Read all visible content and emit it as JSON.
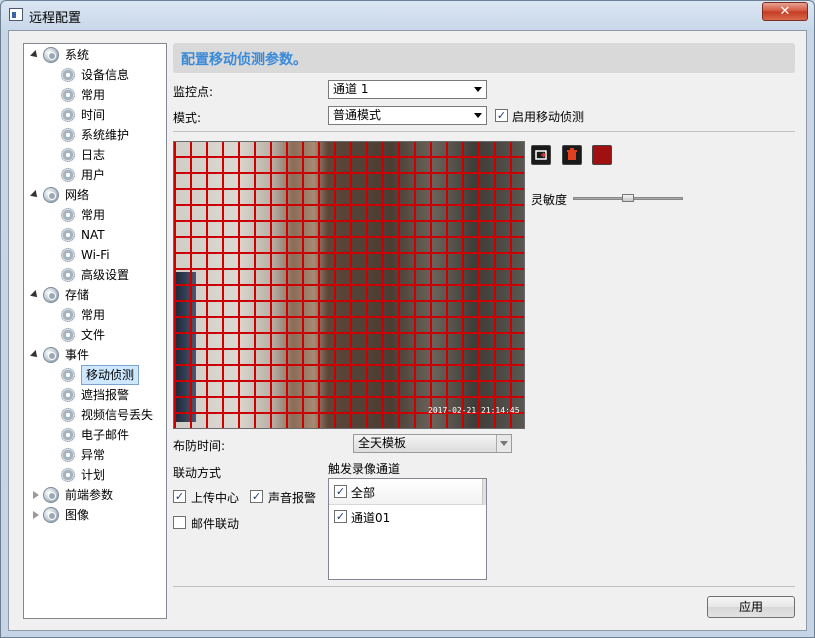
{
  "window": {
    "title": "远程配置",
    "close_glyph": "✕"
  },
  "tree": [
    {
      "label": "系统",
      "type": "category",
      "expanded": true,
      "icon": "globe-gear-icon"
    },
    {
      "label": "设备信息",
      "type": "item",
      "icon": "gear-icon"
    },
    {
      "label": "常用",
      "type": "item",
      "icon": "gear-icon"
    },
    {
      "label": "时间",
      "type": "item",
      "icon": "gear-icon"
    },
    {
      "label": "系统维护",
      "type": "item",
      "icon": "gear-icon"
    },
    {
      "label": "日志",
      "type": "item",
      "icon": "gear-icon"
    },
    {
      "label": "用户",
      "type": "item",
      "icon": "gear-icon"
    },
    {
      "label": "网络",
      "type": "category",
      "expanded": true,
      "icon": "globe-gear-icon"
    },
    {
      "label": "常用",
      "type": "item",
      "icon": "gear-icon"
    },
    {
      "label": "NAT",
      "type": "item",
      "icon": "gear-icon"
    },
    {
      "label": "Wi-Fi",
      "type": "item",
      "icon": "gear-icon"
    },
    {
      "label": "高级设置",
      "type": "item",
      "icon": "gear-icon"
    },
    {
      "label": "存储",
      "type": "category",
      "expanded": true,
      "icon": "globe-gear-icon"
    },
    {
      "label": "常用",
      "type": "item",
      "icon": "gear-icon"
    },
    {
      "label": "文件",
      "type": "item",
      "icon": "gear-icon"
    },
    {
      "label": "事件",
      "type": "category",
      "expanded": true,
      "icon": "globe-gear-icon"
    },
    {
      "label": "移动侦测",
      "type": "item",
      "icon": "gear-icon",
      "selected": true
    },
    {
      "label": "遮挡报警",
      "type": "item",
      "icon": "gear-icon"
    },
    {
      "label": "视频信号丢失",
      "type": "item",
      "icon": "gear-icon"
    },
    {
      "label": "电子邮件",
      "type": "item",
      "icon": "gear-icon"
    },
    {
      "label": "异常",
      "type": "item",
      "icon": "gear-icon"
    },
    {
      "label": "计划",
      "type": "item",
      "icon": "gear-icon"
    },
    {
      "label": "前端参数",
      "type": "category",
      "expanded": false,
      "icon": "globe-gear-icon"
    },
    {
      "label": "图像",
      "type": "category",
      "expanded": false,
      "icon": "globe-gear-icon"
    }
  ],
  "main": {
    "header": "配置移动侦测参数。",
    "channel_label": "监控点:",
    "channel_value": "通道 1",
    "mode_label": "模式:",
    "mode_value": "普通模式",
    "enable_motion_label": "启用移动侦测",
    "enable_motion_checked": true,
    "sensitivity_label": "灵敏度",
    "sensitivity_level": 0.5,
    "video": {
      "osd_top_1": "",
      "osd_top_2": "",
      "timestamp": "2017-02-21 21:14:45"
    },
    "schedule_label": "布防时间:",
    "schedule_value": "全天模板",
    "linkage_label": "联动方式",
    "upload_center_label": "上传中心",
    "upload_center_checked": true,
    "audio_alarm_label": "声音报警",
    "audio_alarm_checked": true,
    "email_linkage_label": "邮件联动",
    "email_linkage_checked": false,
    "trigger_record_label": "触发录像通道",
    "trigger_all_label": "全部",
    "trigger_all_checked": true,
    "trigger_ch01_label": "通道01",
    "trigger_ch01_checked": true,
    "apply_label": "应用"
  },
  "colors": {
    "grid_line": "#cc0000",
    "header_text": "#3b8ad8",
    "selection_bg": "#cde8ff"
  }
}
